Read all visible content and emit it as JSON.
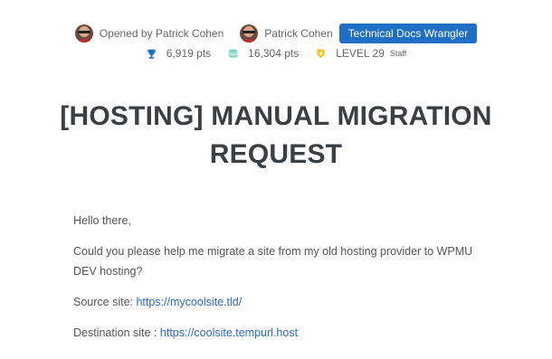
{
  "header": {
    "opened_by": "Opened by Patrick Cohen",
    "author": "Patrick Cohen",
    "role_badge": "Technical Docs Wrangler",
    "stats": {
      "points": "6,919 pts",
      "reputation": "16,304 pts",
      "level": "LEVEL 29",
      "staff": "Staff"
    },
    "colors": {
      "badge_bg": "#1f6fc4",
      "trophy_icon": "#1f6fc4",
      "stack_icon": "#7fd4c5",
      "level_icon": "#f0c419"
    },
    "icons": [
      "avatar-patrick-cohen",
      "trophy-icon",
      "coins-stack-icon",
      "level-badge-icon"
    ]
  },
  "title": "[HOSTING] MANUAL MIGRATION REQUEST",
  "body": {
    "greeting": "Hello there,",
    "request": "Could you please help me migrate a site from my old hosting provider to WPMU DEV hosting?",
    "source_label": "Source site: ",
    "source_url": "https://mycoolsite.tld/",
    "destination_label": "Destination site : ",
    "destination_url": "https://coolsite.tempurl.host",
    "link_color": "#2a6ad2"
  }
}
